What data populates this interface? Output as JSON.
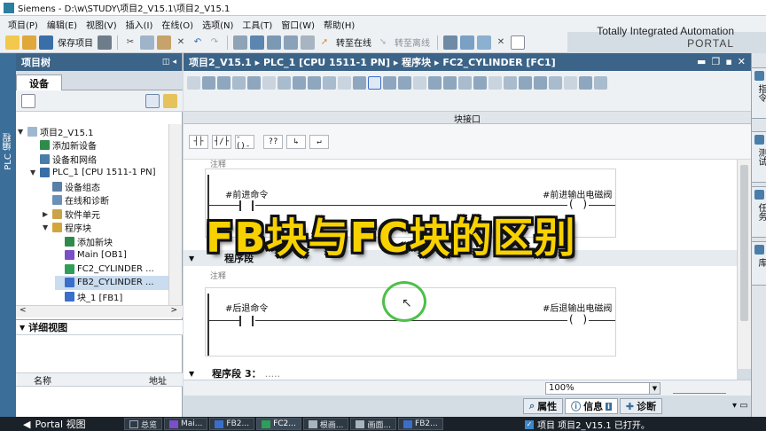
{
  "window": {
    "title": "Siemens  -  D:\\w\\STUDY\\项目2_V15.1\\项目2_V15.1"
  },
  "menu": [
    "项目(P)",
    "编辑(E)",
    "视图(V)",
    "插入(I)",
    "在线(O)",
    "选项(N)",
    "工具(T)",
    "窗口(W)",
    "帮助(H)"
  ],
  "brand": {
    "line1": "Totally Integrated Automation",
    "line2": "PORTAL"
  },
  "toolbar": {
    "save_project": "保存项目",
    "go_online": "转至在线",
    "go_offline": "转至离线"
  },
  "sidebar_left_label": "PLC 编程",
  "project_tree": {
    "title": "项目树",
    "tab": "设备",
    "nodes": [
      {
        "label": "项目2_V15.1",
        "level": 0,
        "expander": "open",
        "selected": false
      },
      {
        "label": "添加新设备",
        "level": 1,
        "expander": "none",
        "selected": false
      },
      {
        "label": "设备和网络",
        "level": 1,
        "expander": "none",
        "selected": false
      },
      {
        "label": "PLC_1 [CPU 1511-1 PN]",
        "level": 1,
        "expander": "open",
        "selected": false
      },
      {
        "label": "设备组态",
        "level": 2,
        "expander": "none",
        "selected": false
      },
      {
        "label": "在线和诊断",
        "level": 2,
        "expander": "none",
        "selected": false
      },
      {
        "label": "软件单元",
        "level": 2,
        "expander": "closed",
        "selected": false
      },
      {
        "label": "程序块",
        "level": 2,
        "expander": "open",
        "selected": false
      },
      {
        "label": "添加新块",
        "level": 3,
        "expander": "none",
        "selected": false
      },
      {
        "label": "Main [OB1]",
        "level": 3,
        "expander": "none",
        "selected": false
      },
      {
        "label": "FC2_CYLINDER ...",
        "level": 3,
        "expander": "none",
        "selected": false
      },
      {
        "label": "FB2_CYLINDER ...",
        "level": 3,
        "expander": "none",
        "selected": true
      },
      {
        "label": "块_1 [FB1]",
        "level": 3,
        "expander": "none",
        "selected": false
      }
    ]
  },
  "detail_view": {
    "title": "详细视图",
    "col_name": "名称",
    "col_address": "地址"
  },
  "editor": {
    "breadcrumb": "项目2_V15.1  ▸  PLC_1 [CPU 1511-1 PN]  ▸  程序块  ▸  FC2_CYLINDER [FC1]",
    "interface_label": "块接口",
    "networks": [
      {
        "comment": "注释",
        "input_tag": "#前进命令",
        "output_tag": "#前进输出电磁阀"
      },
      {
        "segment_label": "程序段",
        "comment": "注释",
        "input_tag": "#后退命令",
        "output_tag": "#后退输出电磁阀"
      }
    ],
    "segment3": {
      "label": "程序段 3：",
      "comment": "....."
    },
    "zoom": "100%"
  },
  "overlay_title": "FB块与FC块的区别",
  "inspector_tabs": {
    "properties": "属性",
    "info": "信息",
    "diagnostics": "诊断"
  },
  "right_tabs": [
    "指令",
    "测试",
    "任务",
    "库"
  ],
  "statusbar": {
    "portal": "Portal 视图",
    "overview": "总览",
    "tabs": [
      "Mai...",
      "FB2...",
      "FC2...",
      "根画...",
      "画面...",
      "FB2..."
    ],
    "active_tab": "FC2...",
    "message": "项目 项目2_V15.1 已打开。"
  },
  "colors": {
    "header_blue": "#3c6488",
    "overlay_yellow": "#f7d200",
    "cursor_ring": "#4fbf4a"
  }
}
